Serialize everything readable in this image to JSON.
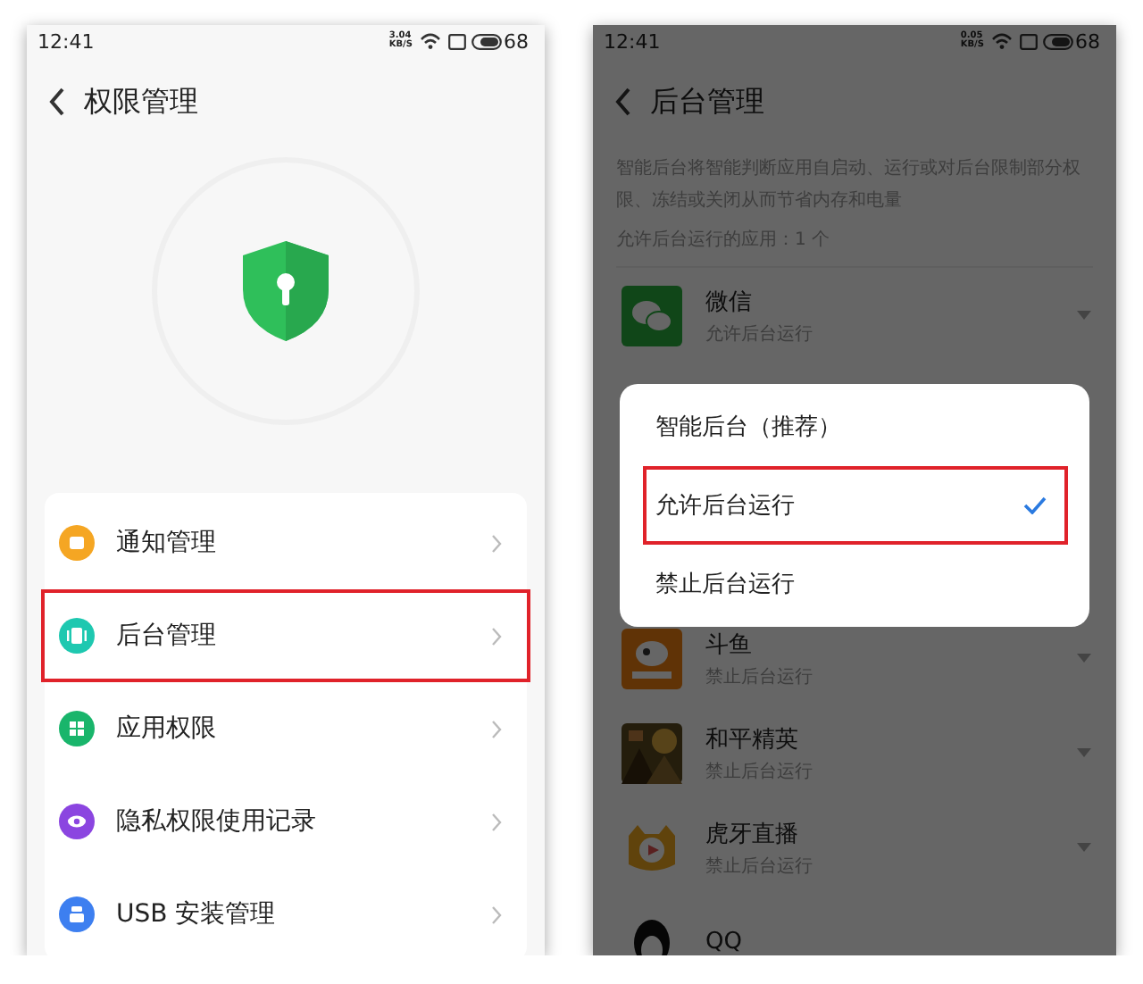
{
  "left": {
    "status": {
      "time": "12:41",
      "speed": [
        "3.04",
        "KB/S"
      ],
      "battery": "68"
    },
    "title": "权限管理",
    "items": [
      {
        "label": "通知管理",
        "color": "#f5a623",
        "kind": "note",
        "highlighted": false
      },
      {
        "label": "后台管理",
        "color": "#1ec8b0",
        "kind": "panel",
        "highlighted": true
      },
      {
        "label": "应用权限",
        "color": "#19b56b",
        "kind": "grid",
        "highlighted": false
      },
      {
        "label": "隐私权限使用记录",
        "color": "#8b45e0",
        "kind": "eye",
        "highlighted": false
      },
      {
        "label": "USB 安装管理",
        "color": "#3d7ff0",
        "kind": "usb",
        "highlighted": false
      }
    ]
  },
  "right": {
    "status": {
      "time": "12:41",
      "speed": [
        "0.05",
        "KB/S"
      ],
      "battery": "68"
    },
    "title": "后台管理",
    "description": "智能后台将智能判断应用自启动、运行或对后台限制部分权限、冻结或关闭从而节省内存和电量",
    "count_label": "允许后台运行的应用：1 个",
    "apps_above": [
      {
        "name": "微信",
        "status": "允许后台运行",
        "kind": "chat"
      }
    ],
    "apps_below": [
      {
        "name": "斗鱼",
        "status": "禁止后台运行",
        "kind": "fish"
      },
      {
        "name": "和平精英",
        "status": "禁止后台运行",
        "kind": "picture"
      },
      {
        "name": "虎牙直播",
        "status": "禁止后台运行",
        "kind": "mascot"
      },
      {
        "name": "QQ",
        "kind": "penguin"
      }
    ],
    "menu": {
      "options": [
        {
          "label": "智能后台（推荐）",
          "selected": false,
          "highlighted": false
        },
        {
          "label": "允许后台运行",
          "selected": true,
          "highlighted": true
        },
        {
          "label": "禁止后台运行",
          "selected": false,
          "highlighted": false
        }
      ]
    }
  }
}
